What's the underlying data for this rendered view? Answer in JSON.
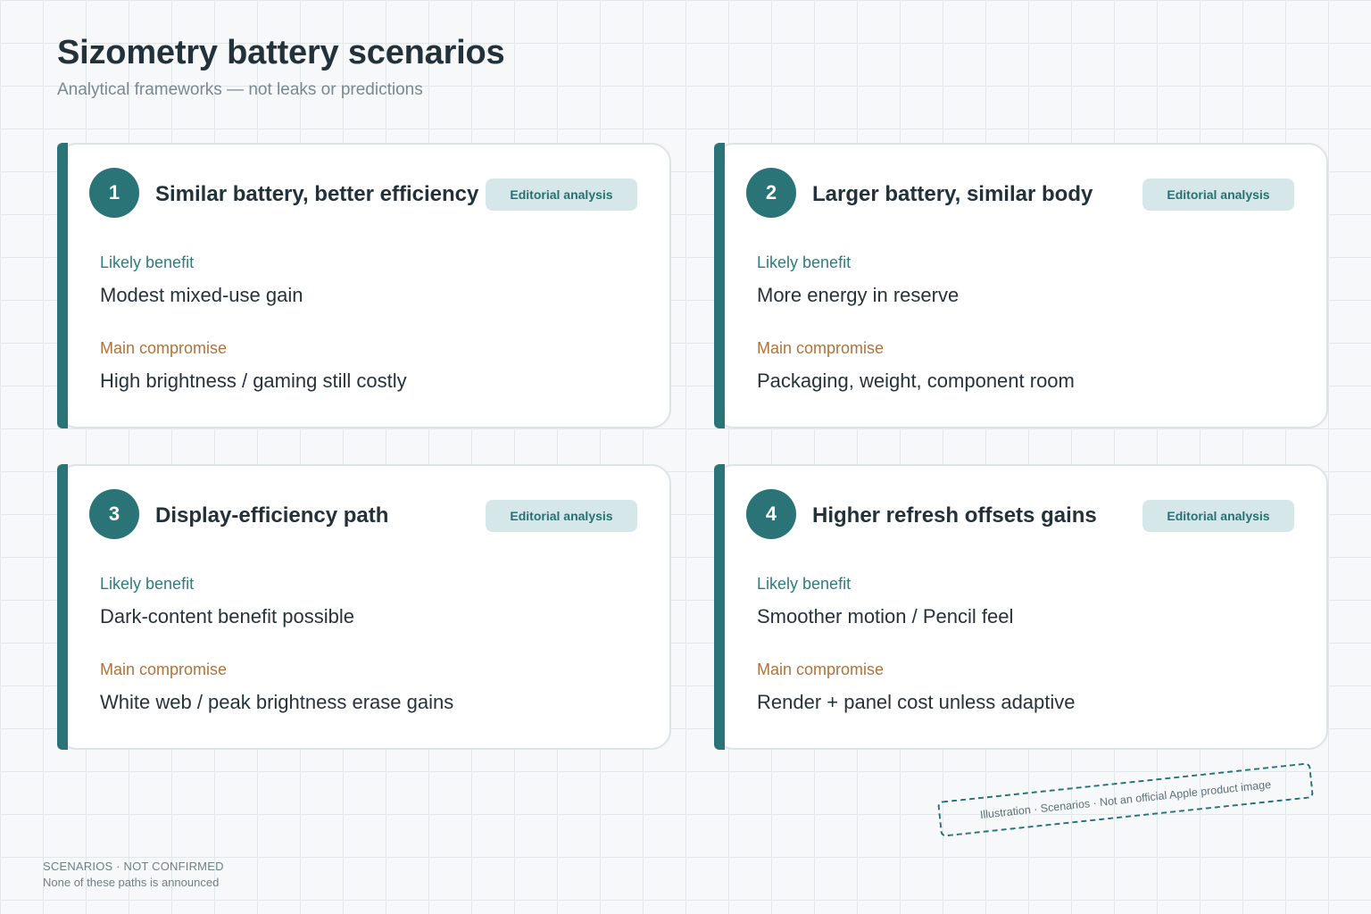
{
  "header": {
    "title": "Sizometry battery scenarios",
    "subtitle": "Analytical frameworks — not leaks or predictions"
  },
  "colors": {
    "accent": "#2a7478",
    "benefit_label": "#2f7b7f",
    "compromise_label": "#b07238",
    "badge_bg": "#d5e7e9"
  },
  "cards": [
    {
      "number": "1",
      "title": "Similar battery, better efficiency",
      "badge": "Editorial analysis",
      "benefit_label": "Likely benefit",
      "benefit": "Modest mixed-use gain",
      "compromise_label": "Main compromise",
      "compromise": "High brightness / gaming still costly"
    },
    {
      "number": "2",
      "title": "Larger battery, similar body",
      "badge": "Editorial analysis",
      "benefit_label": "Likely benefit",
      "benefit": "More energy in reserve",
      "compromise_label": "Main compromise",
      "compromise": "Packaging, weight, component room"
    },
    {
      "number": "3",
      "title": "Display-efficiency path",
      "badge": "Editorial analysis",
      "benefit_label": "Likely benefit",
      "benefit": "Dark-content benefit possible",
      "compromise_label": "Main compromise",
      "compromise": "White web / peak brightness erase gains"
    },
    {
      "number": "4",
      "title": "Higher refresh offsets gains",
      "badge": "Editorial analysis",
      "benefit_label": "Likely benefit",
      "benefit": "Smoother motion / Pencil feel",
      "compromise_label": "Main compromise",
      "compromise": "Render + panel cost unless adaptive"
    }
  ],
  "stamp": {
    "text": "Illustration · Scenarios · Not an official Apple product image"
  },
  "footer": {
    "line1": "SCENARIOS · NOT CONFIRMED",
    "line2": "None of these paths is announced"
  }
}
